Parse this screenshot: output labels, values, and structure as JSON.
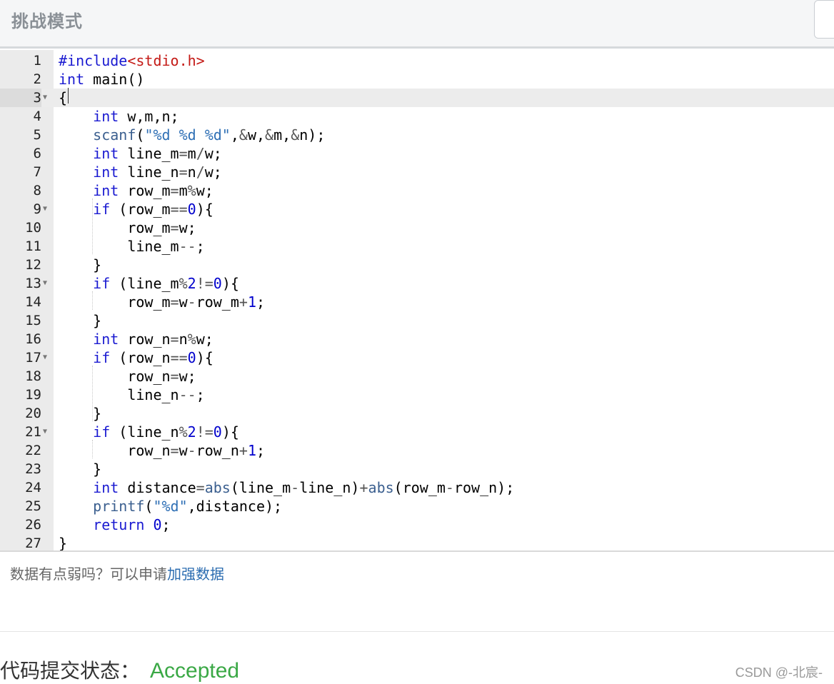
{
  "header": {
    "title": "挑战模式"
  },
  "editor": {
    "lines": [
      {
        "n": "1",
        "html": "<span class=\"pp\">#include</span><span class=\"inc\">&lt;stdio.h&gt;</span>"
      },
      {
        "n": "2",
        "html": "<span class=\"kw\">int</span> main()"
      },
      {
        "n": "3",
        "fold": true,
        "active": true,
        "html": "{"
      },
      {
        "n": "4",
        "html": "    <span class=\"kw\">int</span> w,m,n;"
      },
      {
        "n": "5",
        "html": "    <span class=\"fn\">scanf</span>(<span class=\"str\">\"%d %d %d\"</span>,<span class=\"op\">&amp;</span>w,<span class=\"op\">&amp;</span>m,<span class=\"op\">&amp;</span>n);"
      },
      {
        "n": "6",
        "html": "    <span class=\"kw\">int</span> line_m<span class=\"op\">=</span>m<span class=\"op\">/</span>w;"
      },
      {
        "n": "7",
        "html": "    <span class=\"kw\">int</span> line_n<span class=\"op\">=</span>n<span class=\"op\">/</span>w;"
      },
      {
        "n": "8",
        "html": "    <span class=\"kw\">int</span> row_m<span class=\"op\">=</span>m<span class=\"op\">%</span>w;"
      },
      {
        "n": "9",
        "fold": true,
        "html": "    <span class=\"kw\">if</span> (row_m<span class=\"op\">==</span><span class=\"num\">0</span>){"
      },
      {
        "n": "10",
        "html": "        row_m<span class=\"op\">=</span>w;"
      },
      {
        "n": "11",
        "html": "        line_m<span class=\"op\">--</span>;"
      },
      {
        "n": "12",
        "html": "    }"
      },
      {
        "n": "13",
        "fold": true,
        "html": "    <span class=\"kw\">if</span> (line_m<span class=\"op\">%</span><span class=\"num\">2</span><span class=\"op\">!=</span><span class=\"num\">0</span>){"
      },
      {
        "n": "14",
        "html": "        row_m<span class=\"op\">=</span>w<span class=\"op\">-</span>row_m<span class=\"op\">+</span><span class=\"num\">1</span>;"
      },
      {
        "n": "15",
        "html": "    }"
      },
      {
        "n": "16",
        "html": "    <span class=\"kw\">int</span> row_n<span class=\"op\">=</span>n<span class=\"op\">%</span>w;"
      },
      {
        "n": "17",
        "fold": true,
        "html": "    <span class=\"kw\">if</span> (row_n<span class=\"op\">==</span><span class=\"num\">0</span>){"
      },
      {
        "n": "18",
        "html": "        row_n<span class=\"op\">=</span>w;"
      },
      {
        "n": "19",
        "html": "        line_n<span class=\"op\">--</span>;"
      },
      {
        "n": "20",
        "html": "    }"
      },
      {
        "n": "21",
        "fold": true,
        "html": "    <span class=\"kw\">if</span> (line_n<span class=\"op\">%</span><span class=\"num\">2</span><span class=\"op\">!=</span><span class=\"num\">0</span>){"
      },
      {
        "n": "22",
        "html": "        row_n<span class=\"op\">=</span>w<span class=\"op\">-</span>row_n<span class=\"op\">+</span><span class=\"num\">1</span>;"
      },
      {
        "n": "23",
        "html": "    }"
      },
      {
        "n": "24",
        "html": "    <span class=\"kw\">int</span> distance<span class=\"op\">=</span><span class=\"fn\">abs</span>(line_m<span class=\"op\">-</span>line_n)<span class=\"op\">+</span><span class=\"fn\">abs</span>(row_m<span class=\"op\">-</span>row_n);"
      },
      {
        "n": "25",
        "html": "    <span class=\"fn\">printf</span>(<span class=\"str\">\"%d\"</span>,distance);"
      },
      {
        "n": "26",
        "html": "    <span class=\"kw\">return</span> <span class=\"num\">0</span>;"
      },
      {
        "n": "27",
        "html": "}"
      }
    ]
  },
  "hint": {
    "prefix": "数据有点弱吗？可以申请",
    "link": "加强数据"
  },
  "status": {
    "label": "代码提交状态：",
    "value": "Accepted"
  },
  "watermark": "CSDN @-北宸-",
  "colors": {
    "accepted": "#3aa845",
    "keyword": "#1a1ad1",
    "link": "#2b6cb0"
  }
}
